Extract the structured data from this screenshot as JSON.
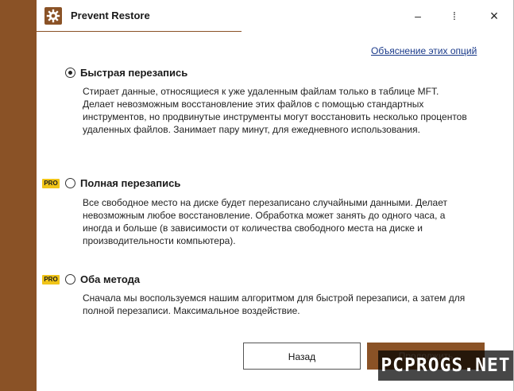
{
  "window": {
    "title": "Prevent Restore",
    "controls": {
      "minimize": "–",
      "more": "⁞",
      "close": "×"
    },
    "accent_color": "#8a5226"
  },
  "info_link": "Объяснение этих опций",
  "options": [
    {
      "title": "Быстрая перезапись",
      "selected": true,
      "pro": false,
      "description": "Стирает данные, относящиеся к уже удаленным файлам только в таблице MFT. Делает невозможным восстановление этих файлов с помощью стандартных инструментов, но продвинутые инструменты могут восстановить несколько процентов удаленных файлов. Занимает пару минут, для ежедневного использования."
    },
    {
      "title": "Полная перезапись",
      "selected": false,
      "pro": true,
      "badge": "PRO",
      "description": "Все свободное место на диске будет перезаписано случайными данными. Делает невозможным любое восстановление. Обработка может занять до одного часа, а иногда и больше (в зависимости от количества свободного места на диске и производительности компьютера)."
    },
    {
      "title": "Оба метода",
      "selected": false,
      "pro": true,
      "badge": "PRO",
      "description": "Сначала мы воспользуемся нашим алгоритмом для быстрой перезаписи, а затем для полной перезаписи. Максимальное воздействие."
    }
  ],
  "buttons": {
    "back": "Назад",
    "next": "Продолжить"
  },
  "watermark": "PCPROGS.NET"
}
